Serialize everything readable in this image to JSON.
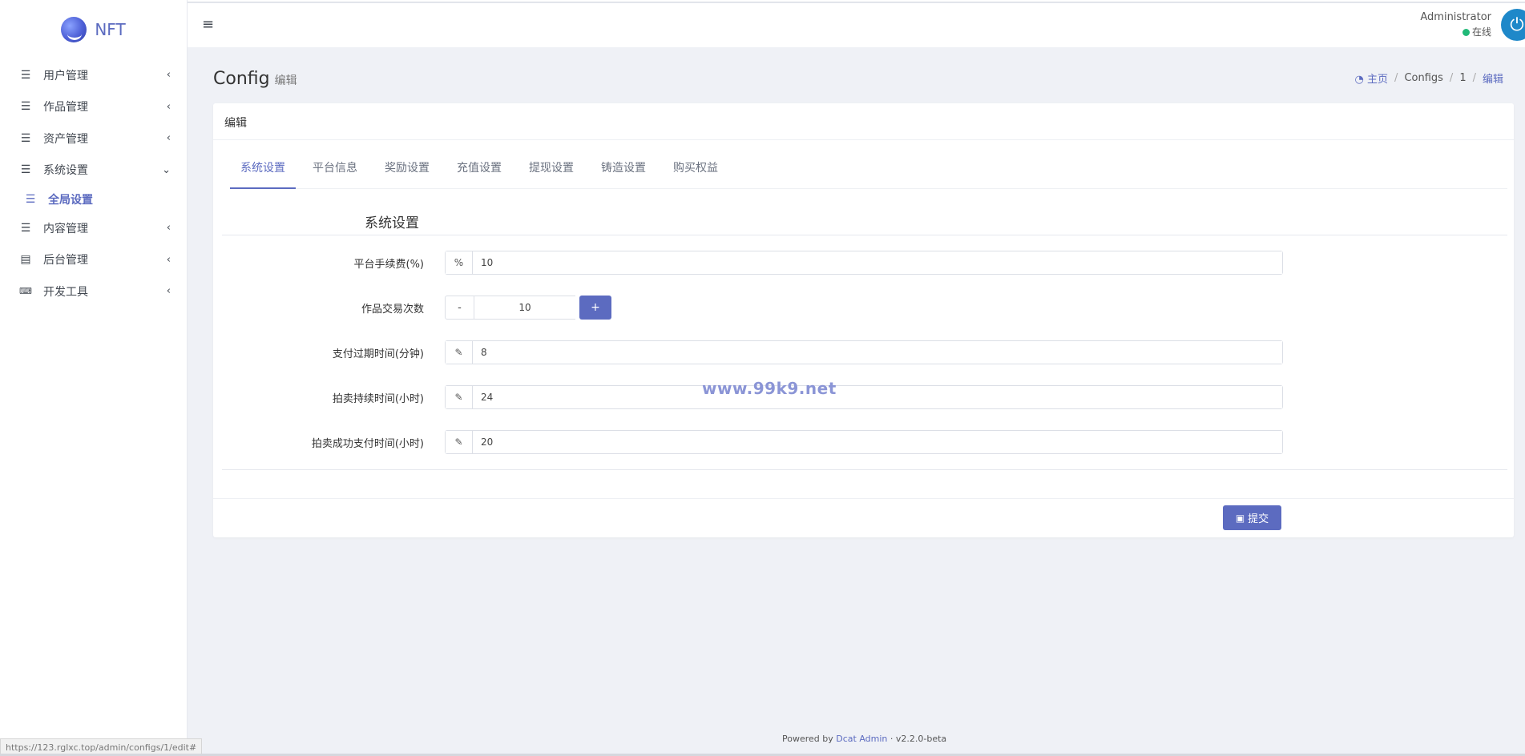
{
  "brand": {
    "name": "NFT",
    "logo_icon": "nft-logo-icon"
  },
  "sidebar": {
    "items": [
      {
        "label": "用户管理",
        "icon": "bars-icon",
        "arrow": "‹"
      },
      {
        "label": "作品管理",
        "icon": "list-icon",
        "arrow": "‹"
      },
      {
        "label": "资产管理",
        "icon": "list-icon",
        "arrow": "‹"
      },
      {
        "label": "系统设置",
        "icon": "bars-icon",
        "arrow": "⌄"
      },
      {
        "label": "内容管理",
        "icon": "bars-icon",
        "arrow": "‹"
      },
      {
        "label": "后台管理",
        "icon": "server-icon",
        "arrow": "‹"
      },
      {
        "label": "开发工具",
        "icon": "keyboard-icon",
        "arrow": "‹"
      }
    ],
    "sub_item": {
      "label": "全局设置",
      "icon": "bars-icon"
    }
  },
  "navbar": {
    "toggle_icon": "≡",
    "user_name": "Administrator",
    "user_status": "在线"
  },
  "header": {
    "title": "Config",
    "subtitle": "编辑",
    "breadcrumb": {
      "home": "主页",
      "items": [
        "Configs",
        "1",
        "编辑"
      ]
    }
  },
  "card": {
    "title": "编辑",
    "tabs": [
      "系统设置",
      "平台信息",
      "奖励设置",
      "充值设置",
      "提现设置",
      "铸造设置",
      "购买权益"
    ],
    "active_tab": 0,
    "section_title": "系统设置",
    "fields": {
      "fee": {
        "label": "平台手续费(%)",
        "addon": "%",
        "value": "10"
      },
      "trade_count": {
        "label": "作品交易次数",
        "minus": "-",
        "value": "10",
        "plus": "+"
      },
      "pay_expire": {
        "label": "支付过期时间(分钟)",
        "value": "8"
      },
      "auction_duration": {
        "label": "拍卖持续时间(小时)",
        "value": "24"
      },
      "auction_pay_time": {
        "label": "拍卖成功支付时间(小时)",
        "value": "20"
      }
    },
    "submit_label": "提交"
  },
  "watermark": "www.99k9.net",
  "footer": {
    "prefix": "Powered by",
    "link": "Dcat Admin",
    "version": "·  v2.2.0-beta"
  },
  "status_url": "https://123.rglxc.top/admin/configs/1/edit#",
  "colors": {
    "accent": "#5c6bc0",
    "online": "#21b978",
    "avatar": "#1e88c9"
  }
}
